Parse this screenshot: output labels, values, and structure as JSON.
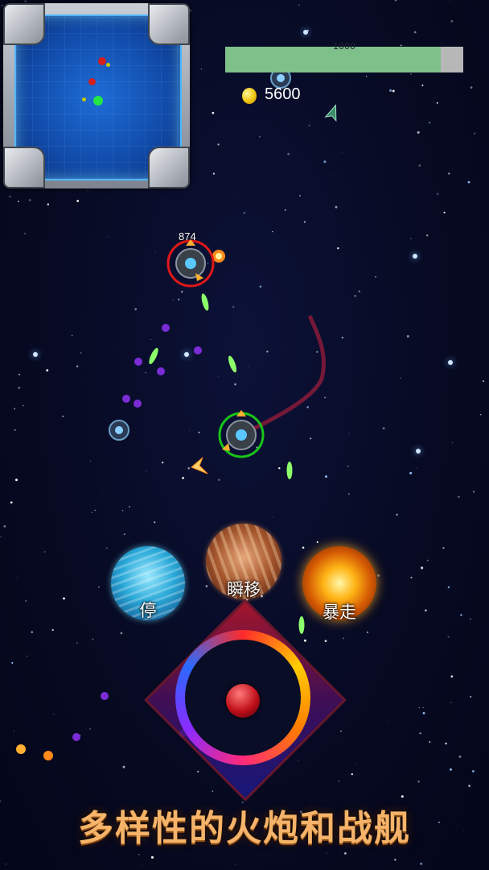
{
  "minimap": {
    "blips": [
      {
        "color": "#d21e1e",
        "kind": "enemy"
      },
      {
        "color": "#c8c800",
        "kind": "item"
      },
      {
        "color": "#d21e1e",
        "kind": "enemy"
      },
      {
        "color": "#c8c800",
        "kind": "item"
      },
      {
        "color": "#22e844",
        "kind": "player"
      }
    ]
  },
  "hud": {
    "hp_value_text": "1000",
    "hp_fraction": 0.906,
    "coins": "5600"
  },
  "enemy": {
    "hp_label": "874",
    "ring_color": "#e01818"
  },
  "player": {
    "ring_color": "#19c419"
  },
  "skills": {
    "stop_label": "停",
    "teleport_label": "瞬移",
    "rampage_label": "暴走"
  },
  "banner": {
    "text": "多样性的火炮和战舰"
  },
  "colors": {
    "projectile_purple": "#7b2cd6",
    "projectile_green": "#8dff6a",
    "trail_red": "#8a1a3a",
    "coin": "#f1c40f"
  }
}
